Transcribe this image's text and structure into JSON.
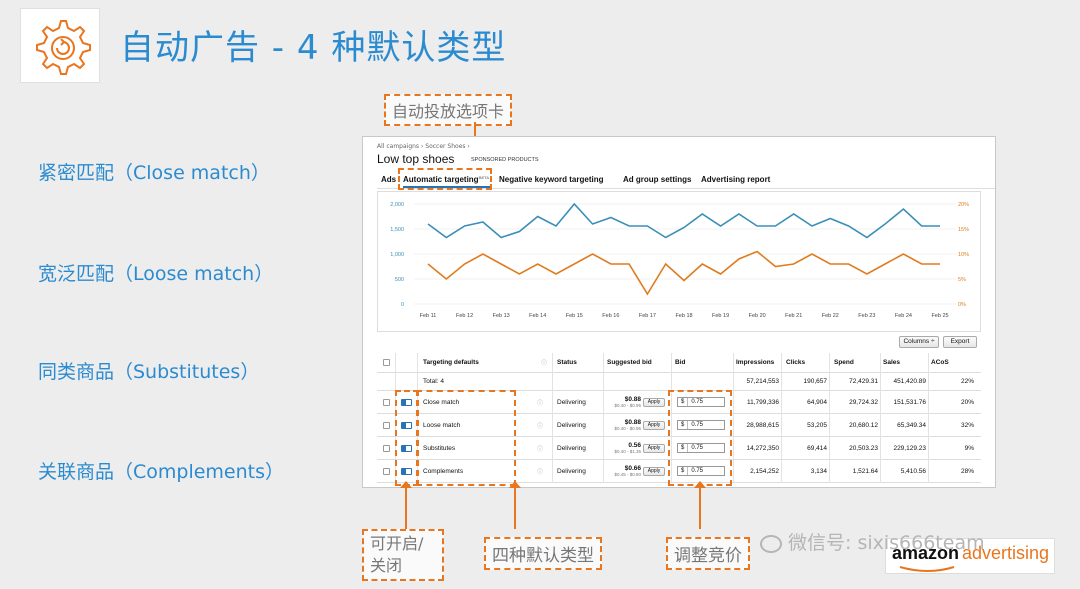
{
  "slide": {
    "title": "自动广告 - 4 种默认类型",
    "left_labels": [
      "紧密匹配（Close match）",
      "宽泛匹配（Loose match）",
      "同类商品（Substitutes）",
      "关联商品（Complements）"
    ],
    "callouts": {
      "top": "自动投放选项卡",
      "toggle": "可开启/\n关闭",
      "types": "四种默认类型",
      "bid": "调整竞价"
    },
    "watermark": "微信号: sixis666team",
    "brand": {
      "left": "amazon",
      "right": "advertising"
    },
    "accent_color": "#2b8bd0",
    "callout_color": "#e8761f"
  },
  "panel": {
    "breadcrumb": "All campaigns › Soccer Shoes ›",
    "page_title": "Low top shoes",
    "campaign_type": "SPONSORED PRODUCTS",
    "tabs": [
      {
        "label": "Ads"
      },
      {
        "label": "Automatic targeting",
        "badge": "BETA",
        "active": true
      },
      {
        "label": "Negative keyword targeting"
      },
      {
        "label": "Ad group settings"
      },
      {
        "label": "Advertising report"
      }
    ],
    "buttons": {
      "columns": "Columns ÷",
      "export": "Export",
      "apply": "Apply"
    },
    "table": {
      "headers": [
        "Targeting defaults",
        "Status",
        "Suggested bid",
        "Bid",
        "Impressions",
        "Clicks",
        "Spend",
        "Sales",
        "ACoS"
      ],
      "total": {
        "label": "Total: 4",
        "impressions": "57,214,553",
        "clicks": "190,657",
        "spend": "72,429.31",
        "sales": "451,420.89",
        "acos": "22%"
      },
      "rows": [
        {
          "name": "Close match",
          "status": "Delivering",
          "suggested": "$0.88",
          "range": "$0.40 - $0.95",
          "currency": "$",
          "bid": "0.75",
          "impressions": "11,799,336",
          "clicks": "64,904",
          "spend": "29,724.32",
          "sales": "151,531.76",
          "acos": "20%"
        },
        {
          "name": "Loose match",
          "status": "Delivering",
          "suggested": "$0.88",
          "range": "$0.40 - $0.95",
          "currency": "$",
          "bid": "0.75",
          "impressions": "28,988,615",
          "clicks": "53,205",
          "spend": "20,680.12",
          "sales": "65,349.34",
          "acos": "32%"
        },
        {
          "name": "Substitutes",
          "status": "Delivering",
          "suggested": "0.56",
          "range": "$0.40 - $1.35",
          "currency": "$",
          "bid": "0.75",
          "impressions": "14,272,350",
          "clicks": "69,414",
          "spend": "20,503.23",
          "sales": "229,129.23",
          "acos": "9%"
        },
        {
          "name": "Complements",
          "status": "Delivering",
          "suggested": "$0.66",
          "range": "$0.45 - $0.80",
          "currency": "$",
          "bid": "0.75",
          "impressions": "2,154,252",
          "clicks": "3,134",
          "spend": "1,521.64",
          "sales": "5,410.56",
          "acos": "28%"
        }
      ]
    }
  },
  "chart_data": {
    "type": "line",
    "categories": [
      "Feb 11",
      "Feb 12",
      "Feb 13",
      "Feb 14",
      "Feb 15",
      "Feb 16",
      "Feb 17",
      "Feb 18",
      "Feb 19",
      "Feb 20",
      "Feb 21",
      "Feb 22",
      "Feb 23",
      "Feb 24",
      "Feb 25"
    ],
    "x": [
      "Feb 11",
      "Feb 11.5",
      "Feb 12",
      "Feb 12.5",
      "Feb 13",
      "Feb 13.5",
      "Feb 14",
      "Feb 14.5",
      "Feb 15",
      "Feb 15.5",
      "Feb 16",
      "Feb 16.5",
      "Feb 17",
      "Feb 17.5",
      "Feb 18",
      "Feb 18.5",
      "Feb 19",
      "Feb 19.5",
      "Feb 20",
      "Feb 20.5",
      "Feb 21",
      "Feb 21.5",
      "Feb 22",
      "Feb 22.5",
      "Feb 23",
      "Feb 23.5",
      "Feb 24",
      "Feb 24.5",
      "Feb 25"
    ],
    "series": [
      {
        "axis": "left",
        "color": "#3a8fb7",
        "values": [
          1600,
          1330,
          1560,
          1640,
          1330,
          1450,
          1750,
          1560,
          2000,
          1600,
          1730,
          1560,
          1560,
          1330,
          1530,
          1800,
          1560,
          1800,
          1560,
          1560,
          1800,
          1560,
          1710,
          1560,
          1330,
          1600,
          1900,
          1560,
          1560
        ]
      },
      {
        "axis": "right",
        "color": "#e07b20",
        "values": [
          8.0,
          5.0,
          8.0,
          10.0,
          8.0,
          6.0,
          8.0,
          6.0,
          8.0,
          10.0,
          8.0,
          8.0,
          2.0,
          8.0,
          4.7,
          8.0,
          6.0,
          9.0,
          10.5,
          7.5,
          8.0,
          10.0,
          8.0,
          8.0,
          6.0,
          8.0,
          10.0,
          8.0,
          8.0
        ]
      }
    ],
    "y_left": {
      "ticks": [
        "2,000",
        "1,500",
        "1,000",
        "500",
        "0"
      ],
      "range": [
        0,
        2000
      ]
    },
    "y_right": {
      "ticks": [
        "20%",
        "15%",
        "10%",
        "5%",
        "0%"
      ],
      "range": [
        0,
        20
      ],
      "color": "#e07b20"
    },
    "grid": true
  }
}
